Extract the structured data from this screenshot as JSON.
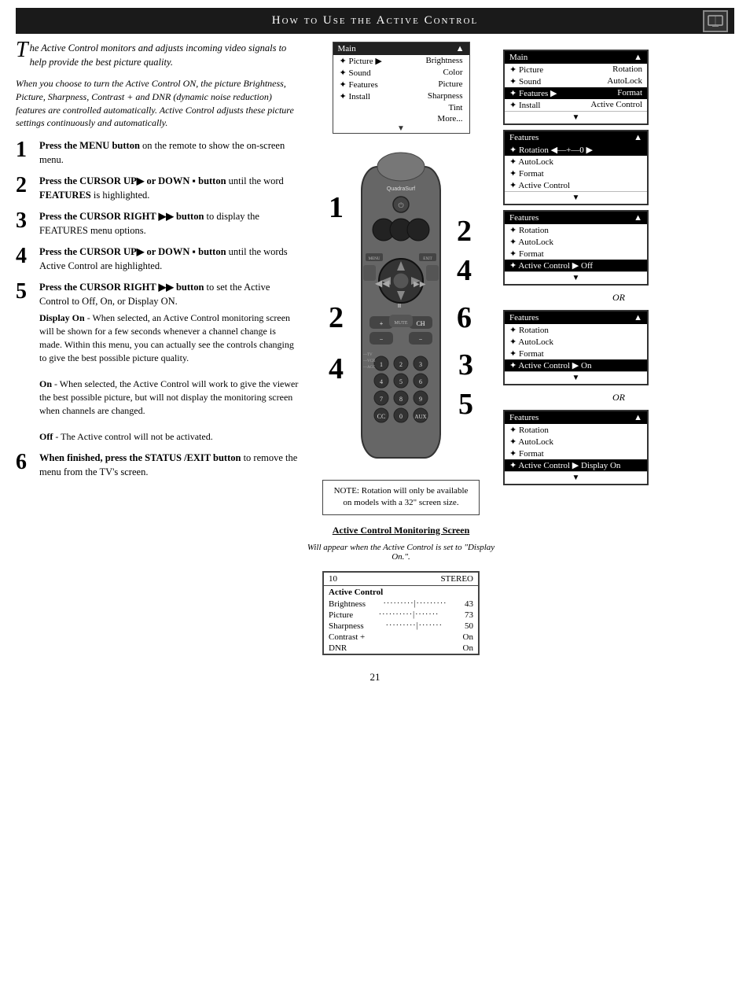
{
  "header": {
    "title": "How to Use the Active Control",
    "icon_label": "TV icon"
  },
  "intro": {
    "drop_cap": "T",
    "text1": "he Active Control monitors and adjusts incoming video signals to help provide the best picture quality.",
    "text2": "When you choose to turn the Active Control ON, the picture Brightness, Picture, Sharpness, Contrast + and DNR (dynamic noise reduction) features are controlled automatically. Active Control adjusts these picture settings continuously and automatically."
  },
  "steps": [
    {
      "number": "1",
      "main": "Press the MENU button on the remote to show the on-screen menu."
    },
    {
      "number": "2",
      "main": "Press the CURSOR UP▶ or DOWN ▪ button until the word FEATURES is highlighted."
    },
    {
      "number": "3",
      "main": "Press the CURSOR RIGHT ▶▶ button to display the FEATURES menu options."
    },
    {
      "number": "4",
      "main": "Press the CURSOR UP▶ or DOWN ▪ button until the words Active Control are highlighted."
    },
    {
      "number": "5",
      "main": "Press the CURSOR RIGHT ▶▶ button to set the Active Control to Off, On, or Display ON.",
      "sub": [
        {
          "label": "Display On",
          "text": "- When selected, an Active Control monitoring screen will be shown for a few seconds whenever a channel change is made. Within this menu, you can actually see the controls changing to give the best possible picture quality."
        },
        {
          "label": "On",
          "text": "- When selected, the Active Control will work to give the viewer the best possible picture, but will not display the monitoring screen when channels are changed."
        },
        {
          "label": "Off",
          "text": "- The Active control will not be activated."
        }
      ]
    },
    {
      "number": "6",
      "main": "When finished, press the STATUS /EXIT button to remove the menu from the TV's screen."
    }
  ],
  "osd_main_menu": {
    "header_left": "Main",
    "header_right": "▲",
    "rows": [
      {
        "left": "✦ Picture",
        "right": "▶  Brightness",
        "hl": false
      },
      {
        "left": "✦ Sound",
        "right": "Color",
        "hl": false
      },
      {
        "left": "✦ Features",
        "right": "Picture",
        "hl": false
      },
      {
        "left": "✦ Install",
        "right": "Sharpness",
        "hl": false
      },
      {
        "left": "",
        "right": "Tint",
        "hl": false
      },
      {
        "left": "",
        "right": "More...",
        "hl": false
      }
    ]
  },
  "note": "NOTE: Rotation will only be available on models with a 32\" screen size.",
  "monitoring_screen_label": "Active Control Monitoring Screen",
  "monitoring_screen_sub": "Will appear when the Active Control is set to \"Display On.\".",
  "monitoring": {
    "channel": "10",
    "stereo": "STEREO",
    "title": "Active Control",
    "rows": [
      {
        "label": "Brightness",
        "dots": "·········|·········",
        "value": "43"
      },
      {
        "label": "Picture",
        "dots": "··········|·······",
        "value": "73"
      },
      {
        "label": "Sharpness",
        "dots": "·········|·······",
        "value": "50"
      },
      {
        "label": "Contrast +",
        "value": "On"
      },
      {
        "label": "DNR",
        "value": "On"
      }
    ]
  },
  "right_osd": {
    "box1": {
      "header": {
        "left": "Main",
        "right": "▲"
      },
      "rows": [
        {
          "left": "✦ Picture",
          "right": "Rotation"
        },
        {
          "left": "✦ Sound",
          "right": "AutoLock"
        },
        {
          "left": "✦ Features  ▶",
          "right": "Format",
          "hl": true
        },
        {
          "left": "✦ Install",
          "right": "Active Control"
        }
      ]
    },
    "box2": {
      "header": {
        "left": "Features",
        "right": "▲"
      },
      "rows": [
        {
          "left": "✦ Rotation  ◀—+—0 ▶",
          "hl": true
        },
        {
          "left": "✦ AutoLock"
        },
        {
          "left": "✦ Format"
        },
        {
          "left": "✦ Active Control"
        }
      ]
    },
    "box3": {
      "header": {
        "left": "Features",
        "right": "▲"
      },
      "rows": [
        {
          "left": "✦ Rotation"
        },
        {
          "left": "✦ AutoLock"
        },
        {
          "left": "✦ Format"
        },
        {
          "left": "✦ Active Control  ▶  Off",
          "hl": true
        }
      ]
    },
    "or1": "OR",
    "box4": {
      "header": {
        "left": "Features",
        "right": "▲"
      },
      "rows": [
        {
          "left": "✦ Rotation"
        },
        {
          "left": "✦ AutoLock"
        },
        {
          "left": "✦ Format"
        },
        {
          "left": "✦ Active Control  ▶  On",
          "hl": true
        }
      ]
    },
    "or2": "OR",
    "box5": {
      "header": {
        "left": "Features",
        "right": "▲"
      },
      "rows": [
        {
          "left": "✦ Rotation"
        },
        {
          "left": "✦ AutoLock"
        },
        {
          "left": "✦ Format"
        },
        {
          "left": "✦ Active Control  ▶  Display On",
          "hl": true
        }
      ]
    }
  },
  "page_number": "21"
}
